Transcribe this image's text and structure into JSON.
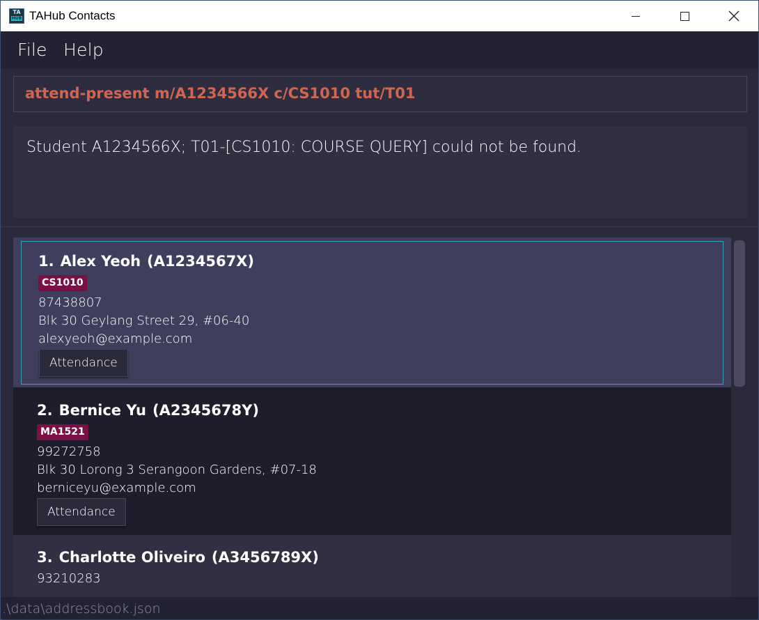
{
  "window": {
    "title": "TAHub Contacts",
    "icon_text_top": "TA",
    "icon_text_bottom": "HUB"
  },
  "menu": {
    "items": [
      {
        "label": "File"
      },
      {
        "label": "Help"
      }
    ]
  },
  "command_box": {
    "value": "attend-present m/A1234566X c/CS1010 tut/T01"
  },
  "result_display": {
    "text": "Student A1234566X; T01-[CS1010: COURSE QUERY] could not be found."
  },
  "contacts": [
    {
      "index": "1.",
      "name": "Alex Yeoh",
      "matric": "(A1234567X)",
      "tag": "CS1010",
      "phone": "87438807",
      "address": "Blk 30 Geylang Street 29, #06-40",
      "email": "alexyeoh@example.com",
      "button_label": "Attendance"
    },
    {
      "index": "2.",
      "name": "Bernice Yu",
      "matric": "(A2345678Y)",
      "tag": "MA1521",
      "phone": "99272758",
      "address": "Blk 30 Lorong 3 Serangoon Gardens, #07-18",
      "email": "berniceyu@example.com",
      "button_label": "Attendance"
    },
    {
      "index": "3.",
      "name": "Charlotte Oliveiro",
      "matric": "(A3456789X)",
      "phone": "93210283"
    }
  ],
  "status_bar": {
    "path": ".\\data\\addressbook.json"
  },
  "colors": {
    "accent_command": "#d06651",
    "tag_background": "#7b1045",
    "selection_border": "#3aa3b8"
  }
}
